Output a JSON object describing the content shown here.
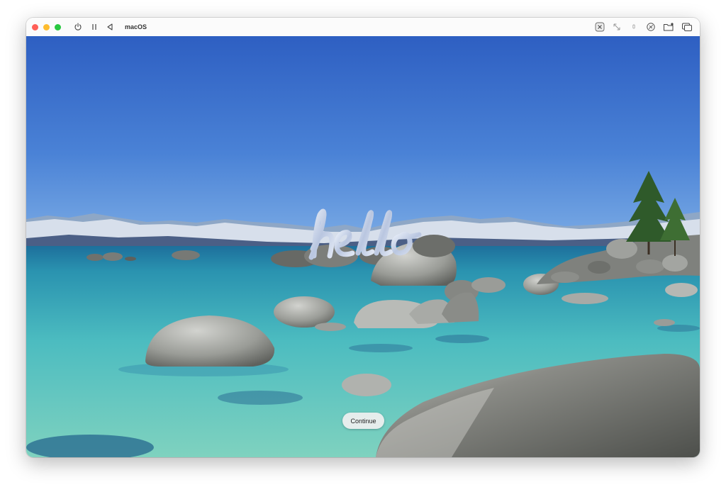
{
  "window": {
    "title": "macOS",
    "controls": {
      "close": {
        "icon": "close-dot",
        "color": "#ff5f57"
      },
      "minimize": {
        "icon": "minimize-dot",
        "color": "#febc2e"
      },
      "zoom": {
        "icon": "zoom-dot",
        "color": "#28c840"
      }
    },
    "toolbar_left": [
      {
        "id": "power",
        "icon": "power-icon"
      },
      {
        "id": "pause",
        "icon": "pause-icon"
      },
      {
        "id": "back",
        "icon": "back-triangle-icon"
      }
    ],
    "toolbar_right": [
      {
        "id": "keyboard",
        "icon": "keyboard-capture-icon"
      },
      {
        "id": "resize",
        "icon": "resize-arrows-icon"
      },
      {
        "id": "mic",
        "icon": "microphone-icon"
      },
      {
        "id": "network",
        "icon": "network-icon"
      },
      {
        "id": "folder",
        "icon": "shared-folder-icon"
      },
      {
        "id": "windows",
        "icon": "window-mode-icon"
      }
    ]
  },
  "setup_screen": {
    "greeting": "hello",
    "continue_label": "Continue"
  },
  "colors": {
    "sky_top": "#2f62c3",
    "sky_bottom": "#6a9be0",
    "water_deep": "#1a7fa6",
    "water_shallow": "#6fcfc4",
    "rock": "#8d8f8b",
    "greeting_tint": "#c8d4ea"
  }
}
